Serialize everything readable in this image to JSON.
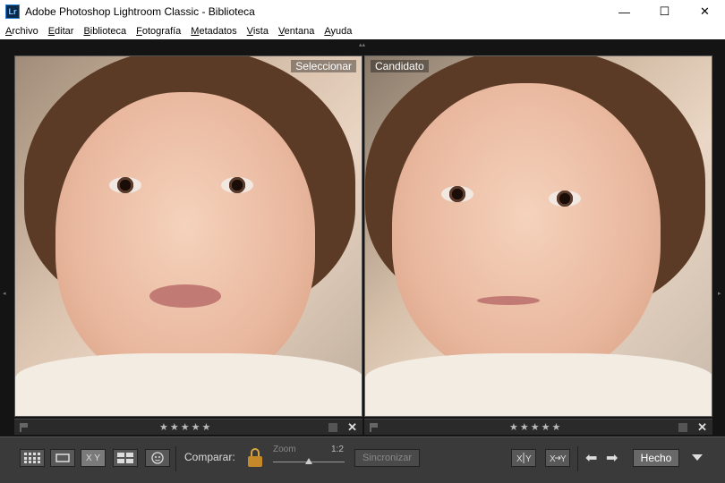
{
  "window": {
    "app_icon": "Lr",
    "title": "Adobe Photoshop Lightroom Classic - Biblioteca",
    "minimize": "—",
    "maximize": "☐",
    "close": "✕"
  },
  "menu": [
    "Archivo",
    "Editar",
    "Biblioteca",
    "Fotografía",
    "Metadatos",
    "Vista",
    "Ventana",
    "Ayuda"
  ],
  "panels": {
    "left_label": "Seleccionar",
    "right_label": "Candidato"
  },
  "rating_bar": {
    "stars": "★★★★★",
    "close": "✕"
  },
  "toolbar": {
    "compare_label": "Comparar:",
    "zoom_label": "Zoom",
    "zoom_ratio": "1:2",
    "zoom_level": 0.5,
    "sync_label": "Sincronizar",
    "done_label": "Hecho",
    "xy_label": "X Y",
    "prev_arrow": "⬅",
    "next_arrow": "➡"
  },
  "icons": {
    "grid": "grid-view-icon",
    "loupe": "loupe-view-icon",
    "compare": "compare-view-icon",
    "survey": "survey-view-icon",
    "people": "people-view-icon",
    "lock": "lock-icon",
    "swap": "swap-icon",
    "select-candidate": "make-select-icon"
  },
  "colors": {
    "accent_lock": "#c48a2a"
  }
}
